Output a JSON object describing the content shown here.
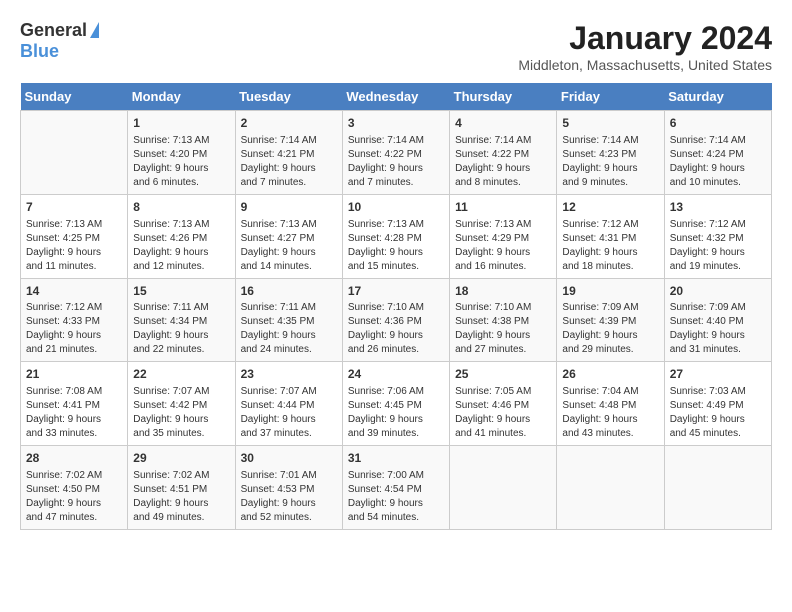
{
  "header": {
    "logo_general": "General",
    "logo_blue": "Blue",
    "month_year": "January 2024",
    "location": "Middleton, Massachusetts, United States"
  },
  "days_of_week": [
    "Sunday",
    "Monday",
    "Tuesday",
    "Wednesday",
    "Thursday",
    "Friday",
    "Saturday"
  ],
  "weeks": [
    [
      {
        "day": "",
        "info": ""
      },
      {
        "day": "1",
        "info": "Sunrise: 7:13 AM\nSunset: 4:20 PM\nDaylight: 9 hours\nand 6 minutes."
      },
      {
        "day": "2",
        "info": "Sunrise: 7:14 AM\nSunset: 4:21 PM\nDaylight: 9 hours\nand 7 minutes."
      },
      {
        "day": "3",
        "info": "Sunrise: 7:14 AM\nSunset: 4:22 PM\nDaylight: 9 hours\nand 7 minutes."
      },
      {
        "day": "4",
        "info": "Sunrise: 7:14 AM\nSunset: 4:22 PM\nDaylight: 9 hours\nand 8 minutes."
      },
      {
        "day": "5",
        "info": "Sunrise: 7:14 AM\nSunset: 4:23 PM\nDaylight: 9 hours\nand 9 minutes."
      },
      {
        "day": "6",
        "info": "Sunrise: 7:14 AM\nSunset: 4:24 PM\nDaylight: 9 hours\nand 10 minutes."
      }
    ],
    [
      {
        "day": "7",
        "info": "Sunrise: 7:13 AM\nSunset: 4:25 PM\nDaylight: 9 hours\nand 11 minutes."
      },
      {
        "day": "8",
        "info": "Sunrise: 7:13 AM\nSunset: 4:26 PM\nDaylight: 9 hours\nand 12 minutes."
      },
      {
        "day": "9",
        "info": "Sunrise: 7:13 AM\nSunset: 4:27 PM\nDaylight: 9 hours\nand 14 minutes."
      },
      {
        "day": "10",
        "info": "Sunrise: 7:13 AM\nSunset: 4:28 PM\nDaylight: 9 hours\nand 15 minutes."
      },
      {
        "day": "11",
        "info": "Sunrise: 7:13 AM\nSunset: 4:29 PM\nDaylight: 9 hours\nand 16 minutes."
      },
      {
        "day": "12",
        "info": "Sunrise: 7:12 AM\nSunset: 4:31 PM\nDaylight: 9 hours\nand 18 minutes."
      },
      {
        "day": "13",
        "info": "Sunrise: 7:12 AM\nSunset: 4:32 PM\nDaylight: 9 hours\nand 19 minutes."
      }
    ],
    [
      {
        "day": "14",
        "info": "Sunrise: 7:12 AM\nSunset: 4:33 PM\nDaylight: 9 hours\nand 21 minutes."
      },
      {
        "day": "15",
        "info": "Sunrise: 7:11 AM\nSunset: 4:34 PM\nDaylight: 9 hours\nand 22 minutes."
      },
      {
        "day": "16",
        "info": "Sunrise: 7:11 AM\nSunset: 4:35 PM\nDaylight: 9 hours\nand 24 minutes."
      },
      {
        "day": "17",
        "info": "Sunrise: 7:10 AM\nSunset: 4:36 PM\nDaylight: 9 hours\nand 26 minutes."
      },
      {
        "day": "18",
        "info": "Sunrise: 7:10 AM\nSunset: 4:38 PM\nDaylight: 9 hours\nand 27 minutes."
      },
      {
        "day": "19",
        "info": "Sunrise: 7:09 AM\nSunset: 4:39 PM\nDaylight: 9 hours\nand 29 minutes."
      },
      {
        "day": "20",
        "info": "Sunrise: 7:09 AM\nSunset: 4:40 PM\nDaylight: 9 hours\nand 31 minutes."
      }
    ],
    [
      {
        "day": "21",
        "info": "Sunrise: 7:08 AM\nSunset: 4:41 PM\nDaylight: 9 hours\nand 33 minutes."
      },
      {
        "day": "22",
        "info": "Sunrise: 7:07 AM\nSunset: 4:42 PM\nDaylight: 9 hours\nand 35 minutes."
      },
      {
        "day": "23",
        "info": "Sunrise: 7:07 AM\nSunset: 4:44 PM\nDaylight: 9 hours\nand 37 minutes."
      },
      {
        "day": "24",
        "info": "Sunrise: 7:06 AM\nSunset: 4:45 PM\nDaylight: 9 hours\nand 39 minutes."
      },
      {
        "day": "25",
        "info": "Sunrise: 7:05 AM\nSunset: 4:46 PM\nDaylight: 9 hours\nand 41 minutes."
      },
      {
        "day": "26",
        "info": "Sunrise: 7:04 AM\nSunset: 4:48 PM\nDaylight: 9 hours\nand 43 minutes."
      },
      {
        "day": "27",
        "info": "Sunrise: 7:03 AM\nSunset: 4:49 PM\nDaylight: 9 hours\nand 45 minutes."
      }
    ],
    [
      {
        "day": "28",
        "info": "Sunrise: 7:02 AM\nSunset: 4:50 PM\nDaylight: 9 hours\nand 47 minutes."
      },
      {
        "day": "29",
        "info": "Sunrise: 7:02 AM\nSunset: 4:51 PM\nDaylight: 9 hours\nand 49 minutes."
      },
      {
        "day": "30",
        "info": "Sunrise: 7:01 AM\nSunset: 4:53 PM\nDaylight: 9 hours\nand 52 minutes."
      },
      {
        "day": "31",
        "info": "Sunrise: 7:00 AM\nSunset: 4:54 PM\nDaylight: 9 hours\nand 54 minutes."
      },
      {
        "day": "",
        "info": ""
      },
      {
        "day": "",
        "info": ""
      },
      {
        "day": "",
        "info": ""
      }
    ]
  ]
}
